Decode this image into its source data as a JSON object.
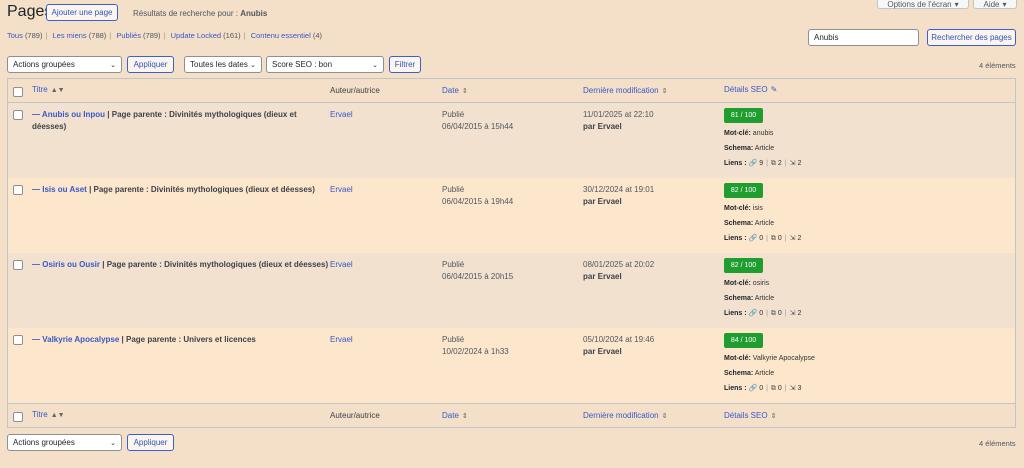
{
  "header": {
    "title": "Pages",
    "add_new": "Ajouter une page",
    "search_results_prefix": "Résultats de recherche pour :",
    "search_term": "Anubis",
    "screen_options": "Options de l'écran",
    "help": "Aide"
  },
  "filters": [
    {
      "label": "Tous",
      "count": "(789)"
    },
    {
      "label": "Les miens",
      "count": "(788)"
    },
    {
      "label": "Publiés",
      "count": "(789)"
    },
    {
      "label": "Update Locked",
      "count": "(161)"
    },
    {
      "label": "Contenu essentiel",
      "count": "(4)"
    }
  ],
  "search": {
    "value": "Anubis",
    "button": "Rechercher des pages"
  },
  "toolbar": {
    "bulk_actions": "Actions groupées",
    "apply": "Appliquer",
    "dates": "Toutes les dates",
    "seo_score": "Score SEO : bon",
    "filter": "Filtrer",
    "count": "4 éléments"
  },
  "columns": {
    "title": "Titre",
    "author": "Auteur/autrice",
    "date": "Date",
    "modified": "Dernière modification",
    "seo": "Détails SEO"
  },
  "rows": [
    {
      "title": "— Anubis ou Inpou",
      "parent": "| Page parente : Divinités mythologiques (dieux et déesses)",
      "author": "Ervael",
      "status": "Publié",
      "date": "06/04/2015 à 15h44",
      "modified": "11/01/2025 at 22:10",
      "modified_by": "par Ervael",
      "score": "81 / 100",
      "keyword_label": "Mot-clé:",
      "keyword": "anubis",
      "schema_label": "Schema:",
      "schema": "Article",
      "links_label": "Liens :",
      "internal": "9",
      "external": "2",
      "incoming": "2"
    },
    {
      "title": "— Isis ou Aset",
      "parent": "| Page parente : Divinités mythologiques (dieux et déesses)",
      "author": "Ervael",
      "status": "Publié",
      "date": "06/04/2015 à 19h44",
      "modified": "30/12/2024 at 19:01",
      "modified_by": "par Ervael",
      "score": "82 / 100",
      "keyword_label": "Mot-clé:",
      "keyword": "isis",
      "schema_label": "Schema:",
      "schema": "Article",
      "links_label": "Liens :",
      "internal": "0",
      "external": "0",
      "incoming": "2"
    },
    {
      "title": "— Osiris ou Ousir",
      "parent": "| Page parente : Divinités mythologiques (dieux et déesses)",
      "author": "Ervael",
      "status": "Publié",
      "date": "06/04/2015 à 20h15",
      "modified": "08/01/2025 at 20:02",
      "modified_by": "par Ervael",
      "score": "82 / 100",
      "keyword_label": "Mot-clé:",
      "keyword": "osiris",
      "schema_label": "Schema:",
      "schema": "Article",
      "links_label": "Liens :",
      "internal": "0",
      "external": "0",
      "incoming": "2"
    },
    {
      "title": "— Valkyrie Apocalypse",
      "parent": "| Page parente : Univers et licences",
      "author": "Ervael",
      "status": "Publié",
      "date": "10/02/2024 à 1h33",
      "modified": "05/10/2024 at 19:46",
      "modified_by": "par Ervael",
      "score": "84 / 100",
      "keyword_label": "Mot-clé:",
      "keyword": "Valkyrie Apocalypse",
      "schema_label": "Schema:",
      "schema": "Article",
      "links_label": "Liens :",
      "internal": "0",
      "external": "0",
      "incoming": "3"
    }
  ],
  "bottom_toolbar": {
    "bulk_actions": "Actions groupées",
    "apply": "Appliquer",
    "count": "4 éléments"
  }
}
